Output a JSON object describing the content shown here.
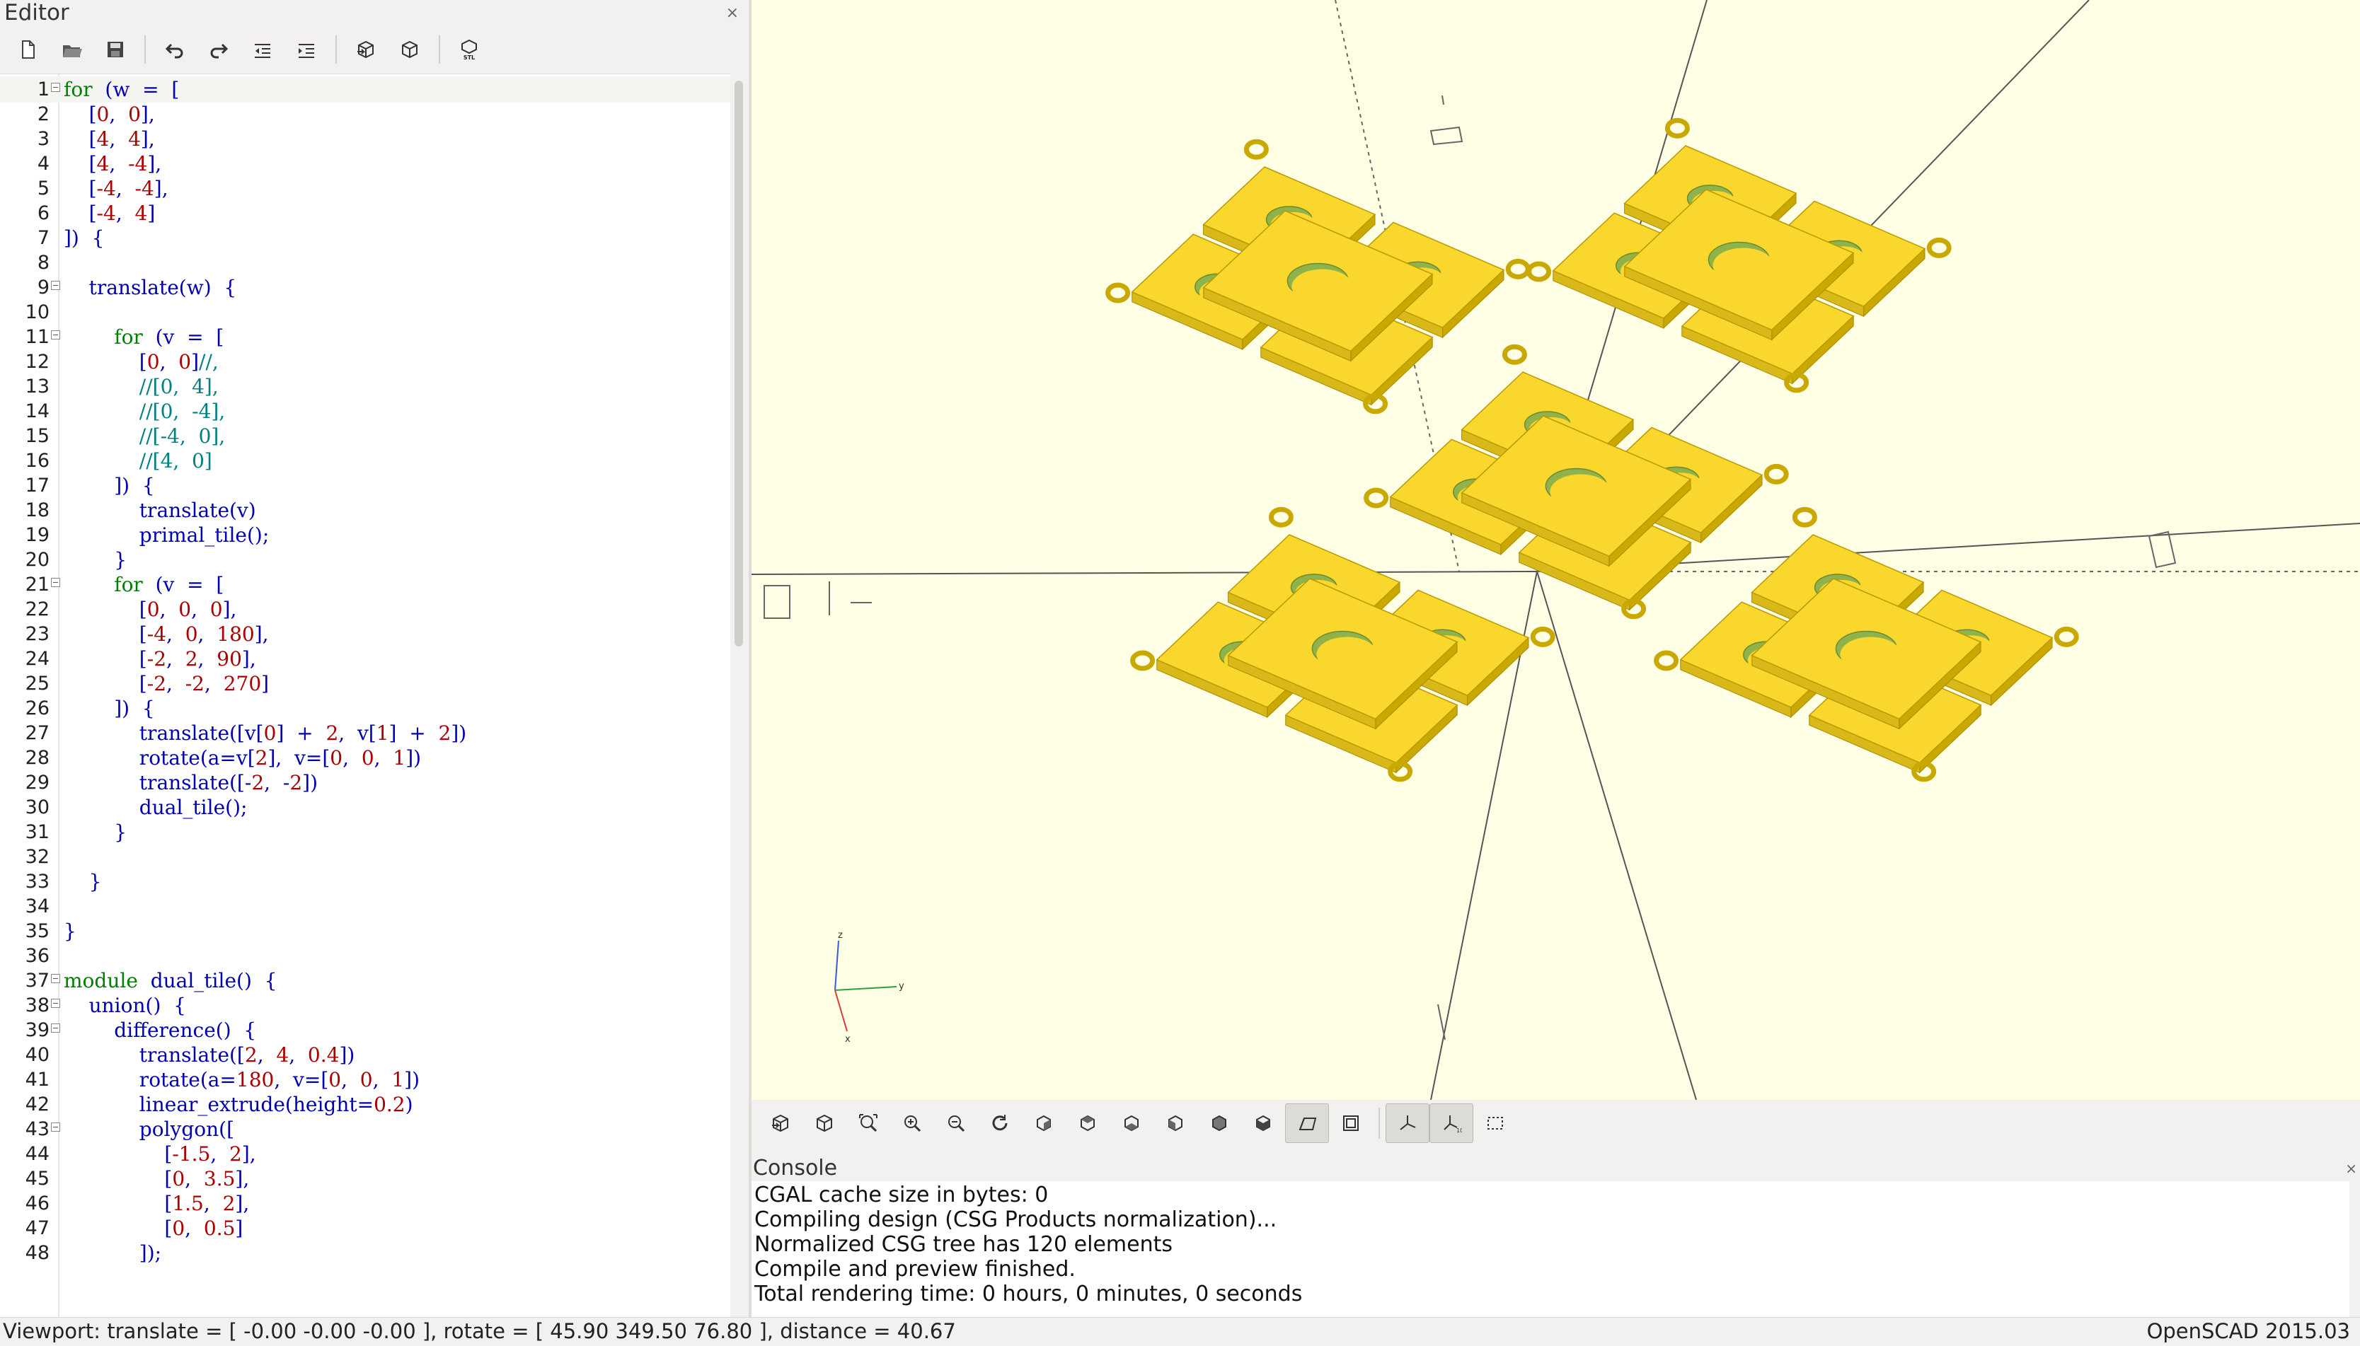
{
  "editor": {
    "title": "Editor",
    "close_glyph": "×",
    "toolbar": [
      {
        "name": "new-file-icon"
      },
      {
        "name": "open-file-icon"
      },
      {
        "name": "save-file-icon"
      },
      {
        "sep": true
      },
      {
        "name": "undo-icon"
      },
      {
        "name": "redo-icon"
      },
      {
        "name": "unindent-icon"
      },
      {
        "name": "indent-icon"
      },
      {
        "sep": true
      },
      {
        "name": "preview-icon"
      },
      {
        "name": "render-icon"
      },
      {
        "sep": true
      },
      {
        "name": "export-stl-icon",
        "text": "STL"
      }
    ],
    "lines": [
      {
        "n": "1",
        "fold": true,
        "t": [
          [
            "kw",
            "for"
          ],
          [
            "",
            "  (w  =  ["
          ]
        ]
      },
      {
        "n": "2",
        "t": [
          [
            "",
            "    ["
          ],
          [
            "num",
            "0"
          ],
          [
            "",
            ",  "
          ],
          [
            "num",
            "0"
          ],
          [
            "",
            "],"
          ]
        ]
      },
      {
        "n": "3",
        "t": [
          [
            "",
            "    ["
          ],
          [
            "num",
            "4"
          ],
          [
            "",
            ",  "
          ],
          [
            "num",
            "4"
          ],
          [
            "",
            "],"
          ]
        ]
      },
      {
        "n": "4",
        "t": [
          [
            "",
            "    ["
          ],
          [
            "num",
            "4"
          ],
          [
            "",
            ",  "
          ],
          [
            "num",
            "-4"
          ],
          [
            "",
            "],"
          ]
        ]
      },
      {
        "n": "5",
        "t": [
          [
            "",
            "    ["
          ],
          [
            "num",
            "-4"
          ],
          [
            "",
            ",  "
          ],
          [
            "num",
            "-4"
          ],
          [
            "",
            "],"
          ]
        ]
      },
      {
        "n": "6",
        "t": [
          [
            "",
            "    ["
          ],
          [
            "num",
            "-4"
          ],
          [
            "",
            ",  "
          ],
          [
            "num",
            "4"
          ],
          [
            "",
            "]"
          ]
        ]
      },
      {
        "n": "7",
        "t": [
          [
            "",
            "])  {"
          ]
        ]
      },
      {
        "n": "8",
        "t": []
      },
      {
        "n": "9",
        "fold": true,
        "t": [
          [
            "",
            "    translate(w)  {"
          ]
        ]
      },
      {
        "n": "10",
        "t": []
      },
      {
        "n": "11",
        "fold": true,
        "t": [
          [
            "",
            "        "
          ],
          [
            "kw",
            "for"
          ],
          [
            "",
            "  (v  =  ["
          ]
        ]
      },
      {
        "n": "12",
        "t": [
          [
            "",
            "            ["
          ],
          [
            "num",
            "0"
          ],
          [
            "",
            ",  "
          ],
          [
            "num",
            "0"
          ],
          [
            "",
            "]"
          ],
          [
            "cm",
            "//,"
          ]
        ]
      },
      {
        "n": "13",
        "t": [
          [
            "cm",
            "            //[0,  4],"
          ]
        ]
      },
      {
        "n": "14",
        "t": [
          [
            "cm",
            "            //[0,  -4],"
          ]
        ]
      },
      {
        "n": "15",
        "t": [
          [
            "cm",
            "            //[-4,  0],"
          ]
        ]
      },
      {
        "n": "16",
        "t": [
          [
            "cm",
            "            //[4,  0]"
          ]
        ]
      },
      {
        "n": "17",
        "t": [
          [
            "",
            "        ])  {"
          ]
        ]
      },
      {
        "n": "18",
        "t": [
          [
            "",
            "            translate(v)"
          ]
        ]
      },
      {
        "n": "19",
        "t": [
          [
            "",
            "            primal_tile();"
          ]
        ]
      },
      {
        "n": "20",
        "t": [
          [
            "",
            "        }"
          ]
        ]
      },
      {
        "n": "21",
        "fold": true,
        "t": [
          [
            "",
            "        "
          ],
          [
            "kw",
            "for"
          ],
          [
            "",
            "  (v  =  ["
          ]
        ]
      },
      {
        "n": "22",
        "t": [
          [
            "",
            "            ["
          ],
          [
            "num",
            "0"
          ],
          [
            "",
            ",  "
          ],
          [
            "num",
            "0"
          ],
          [
            "",
            ",  "
          ],
          [
            "num",
            "0"
          ],
          [
            "",
            "],"
          ]
        ]
      },
      {
        "n": "23",
        "t": [
          [
            "",
            "            ["
          ],
          [
            "num",
            "-4"
          ],
          [
            "",
            ",  "
          ],
          [
            "num",
            "0"
          ],
          [
            "",
            ",  "
          ],
          [
            "num",
            "180"
          ],
          [
            "",
            "],"
          ]
        ]
      },
      {
        "n": "24",
        "t": [
          [
            "",
            "            ["
          ],
          [
            "num",
            "-2"
          ],
          [
            "",
            ",  "
          ],
          [
            "num",
            "2"
          ],
          [
            "",
            ",  "
          ],
          [
            "num",
            "90"
          ],
          [
            "",
            "],"
          ]
        ]
      },
      {
        "n": "25",
        "t": [
          [
            "",
            "            ["
          ],
          [
            "num",
            "-2"
          ],
          [
            "",
            ",  "
          ],
          [
            "num",
            "-2"
          ],
          [
            "",
            ",  "
          ],
          [
            "num",
            "270"
          ],
          [
            "",
            "]"
          ]
        ]
      },
      {
        "n": "26",
        "t": [
          [
            "",
            "        ])  {"
          ]
        ]
      },
      {
        "n": "27",
        "t": [
          [
            "",
            "            translate([v["
          ],
          [
            "num",
            "0"
          ],
          [
            "",
            "]  +  "
          ],
          [
            "num",
            "2"
          ],
          [
            "",
            ",  v["
          ],
          [
            "num",
            "1"
          ],
          [
            "",
            "]  +  "
          ],
          [
            "num",
            "2"
          ],
          [
            "",
            "])"
          ]
        ]
      },
      {
        "n": "28",
        "t": [
          [
            "",
            "            rotate(a=v["
          ],
          [
            "num",
            "2"
          ],
          [
            "",
            "],  v=["
          ],
          [
            "num",
            "0"
          ],
          [
            "",
            ",  "
          ],
          [
            "num",
            "0"
          ],
          [
            "",
            ",  "
          ],
          [
            "num",
            "1"
          ],
          [
            "",
            "])"
          ]
        ]
      },
      {
        "n": "29",
        "t": [
          [
            "",
            "            translate([-"
          ],
          [
            "num",
            "2"
          ],
          [
            "",
            ",  -"
          ],
          [
            "num",
            "2"
          ],
          [
            "",
            "])"
          ]
        ]
      },
      {
        "n": "30",
        "t": [
          [
            "",
            "            dual_tile();"
          ]
        ]
      },
      {
        "n": "31",
        "t": [
          [
            "",
            "        }"
          ]
        ]
      },
      {
        "n": "32",
        "t": []
      },
      {
        "n": "33",
        "t": [
          [
            "",
            "    }"
          ]
        ]
      },
      {
        "n": "34",
        "t": []
      },
      {
        "n": "35",
        "t": [
          [
            "",
            "}"
          ]
        ]
      },
      {
        "n": "36",
        "t": []
      },
      {
        "n": "37",
        "fold": true,
        "t": [
          [
            "kw",
            "module"
          ],
          [
            "",
            "  dual_tile()  {"
          ]
        ]
      },
      {
        "n": "38",
        "fold": true,
        "t": [
          [
            "",
            "    union()  {"
          ]
        ]
      },
      {
        "n": "39",
        "fold": true,
        "t": [
          [
            "",
            "        difference()  {"
          ]
        ]
      },
      {
        "n": "40",
        "t": [
          [
            "",
            "            translate(["
          ],
          [
            "num",
            "2"
          ],
          [
            "",
            ",  "
          ],
          [
            "num",
            "4"
          ],
          [
            "",
            ",  "
          ],
          [
            "num",
            "0.4"
          ],
          [
            "",
            "])"
          ]
        ]
      },
      {
        "n": "41",
        "t": [
          [
            "",
            "            rotate(a="
          ],
          [
            "num",
            "180"
          ],
          [
            "",
            ",  v=["
          ],
          [
            "num",
            "0"
          ],
          [
            "",
            ",  "
          ],
          [
            "num",
            "0"
          ],
          [
            "",
            ",  "
          ],
          [
            "num",
            "1"
          ],
          [
            "",
            "])"
          ]
        ]
      },
      {
        "n": "42",
        "t": [
          [
            "",
            "            linear_extrude(height="
          ],
          [
            "num",
            "0.2"
          ],
          [
            "",
            ")"
          ]
        ]
      },
      {
        "n": "43",
        "fold": true,
        "t": [
          [
            "",
            "            polygon(["
          ]
        ]
      },
      {
        "n": "44",
        "t": [
          [
            "",
            "                ["
          ],
          [
            "num",
            "-1.5"
          ],
          [
            "",
            ",  "
          ],
          [
            "num",
            "2"
          ],
          [
            "",
            "],"
          ]
        ]
      },
      {
        "n": "45",
        "t": [
          [
            "",
            "                ["
          ],
          [
            "num",
            "0"
          ],
          [
            "",
            ",  "
          ],
          [
            "num",
            "3.5"
          ],
          [
            "",
            "],"
          ]
        ]
      },
      {
        "n": "46",
        "t": [
          [
            "",
            "                ["
          ],
          [
            "num",
            "1.5"
          ],
          [
            "",
            ",  "
          ],
          [
            "num",
            "2"
          ],
          [
            "",
            "],"
          ]
        ]
      },
      {
        "n": "47",
        "t": [
          [
            "",
            "                ["
          ],
          [
            "num",
            "0"
          ],
          [
            "",
            ",  "
          ],
          [
            "num",
            "0.5"
          ],
          [
            "",
            "]"
          ]
        ]
      },
      {
        "n": "48",
        "t": [
          [
            "",
            "            ]);"
          ]
        ]
      }
    ]
  },
  "viewport": {
    "background": "#ffffe5",
    "model_color": "#f9d72c",
    "model_edge": "#c9a800",
    "hole_color": "#8fb34a",
    "axes_labels": {
      "z": "z",
      "y": "y",
      "x": "x"
    }
  },
  "view_toolbar": [
    {
      "name": "preview-icon"
    },
    {
      "name": "render-icon"
    },
    {
      "name": "view-all-icon"
    },
    {
      "name": "zoom-in-icon"
    },
    {
      "name": "zoom-out-icon"
    },
    {
      "name": "reset-view-icon"
    },
    {
      "name": "view-right-icon"
    },
    {
      "name": "view-top-icon"
    },
    {
      "name": "view-bottom-icon"
    },
    {
      "name": "view-left-icon"
    },
    {
      "name": "view-front-icon"
    },
    {
      "name": "view-back-icon"
    },
    {
      "name": "perspective-icon",
      "active": true
    },
    {
      "name": "orthogonal-icon"
    },
    {
      "sep": true
    },
    {
      "name": "show-axes-icon",
      "active": true
    },
    {
      "name": "show-scale-markers-icon",
      "active": true
    },
    {
      "name": "show-edges-icon"
    }
  ],
  "console": {
    "title": "Console",
    "close_glyph": "×",
    "lines": [
      "CGAL cache size in bytes: 0",
      "Compiling design (CSG Products normalization)...",
      "Normalized CSG tree has 120 elements",
      "Compile and preview finished.",
      "Total rendering time: 0 hours, 0 minutes, 0 seconds"
    ]
  },
  "status": {
    "viewport_info": "Viewport: translate = [ -0.00 -0.00 -0.00 ], rotate = [ 45.90 349.50 76.80 ], distance = 40.67",
    "app_version": "OpenSCAD 2015.03"
  }
}
